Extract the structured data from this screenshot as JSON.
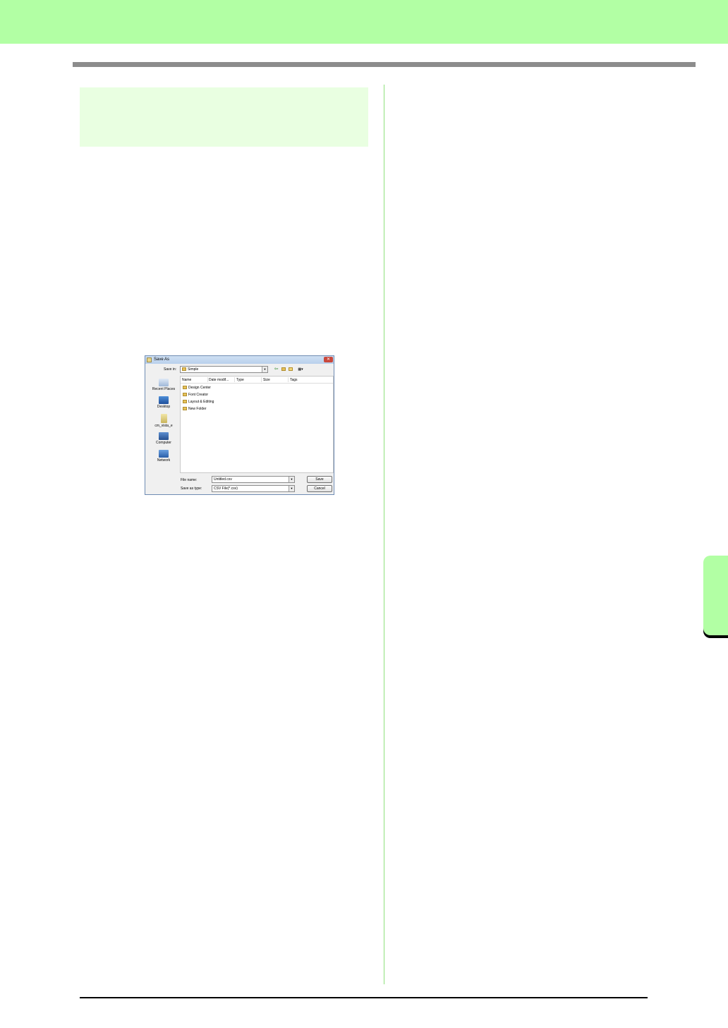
{
  "dialog": {
    "title": "Save As",
    "close_glyph": "✕",
    "save_in_label": "Save in:",
    "save_in_value": "Simple",
    "toolbar_icons": [
      "back-arrow-icon",
      "up-folder-icon",
      "new-folder-icon",
      "views-menu-icon"
    ],
    "places": [
      {
        "label": "Recent Places",
        "icon": "recent-places-icon"
      },
      {
        "label": "Desktop",
        "icon": "desktop-icon"
      },
      {
        "label": "cm_vista_e",
        "icon": "user-folder-icon"
      },
      {
        "label": "Computer",
        "icon": "computer-icon"
      },
      {
        "label": "Network",
        "icon": "network-icon"
      }
    ],
    "columns": [
      "Name",
      "Date modif...",
      "Type",
      "Size",
      "Tags"
    ],
    "folders": [
      "Design Center",
      "Font Creator",
      "Layout & Editing",
      "New Folder"
    ],
    "file_name_label": "File name:",
    "file_name_value": "Untitled.csv",
    "save_as_type_label": "Save as type:",
    "save_as_type_value": "CSV File(*.csv)",
    "save_button": "Save",
    "cancel_button": "Cancel"
  },
  "colors": {
    "header_band": "#b2ffa4",
    "section_box": "#e9ffe1",
    "column_divider": "#8ee07c",
    "rule": "#8c8c8c"
  }
}
